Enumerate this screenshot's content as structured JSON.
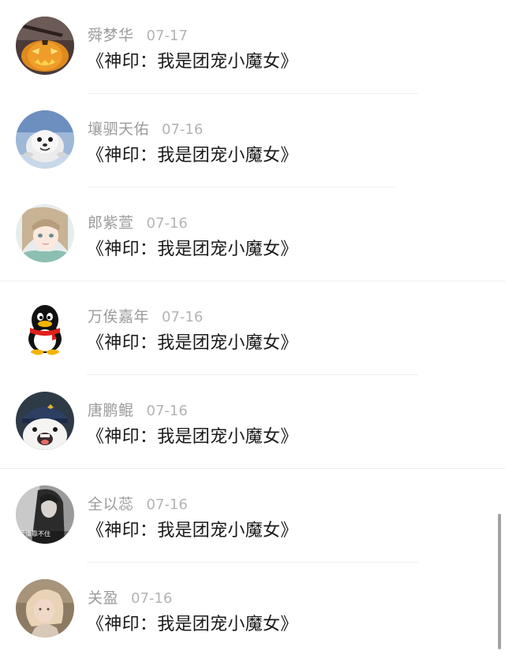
{
  "comments": [
    {
      "name": "舜梦华",
      "date": "07-17",
      "text": "《神印：我是团宠小魔女》",
      "avatar": "pumpkin-lantern-avatar"
    },
    {
      "name": "壤驷天佑",
      "date": "07-16",
      "text": "《神印：我是团宠小魔女》",
      "avatar": "seal-avatar"
    },
    {
      "name": "郎紫萱",
      "date": "07-16",
      "text": "《神印：我是团宠小魔女》",
      "avatar": "anime-girl-avatar"
    },
    {
      "name": "万俟嘉年",
      "date": "07-16",
      "text": "《神印：我是团宠小魔女》",
      "avatar": "penguin-avatar"
    },
    {
      "name": "唐鹏鲲",
      "date": "07-16",
      "text": "《神印：我是团宠小魔女》",
      "avatar": "cartoon-bear-avatar"
    },
    {
      "name": "全以蕊",
      "date": "07-16",
      "text": "《神印：我是团宠小魔女》",
      "avatar": "photo-avatar",
      "avatar_caption": "爱情靠不住"
    },
    {
      "name": "关盈",
      "date": "07-16",
      "text": "《神印：我是团宠小魔女》",
      "avatar": "girl-photo-avatar"
    }
  ],
  "colors": {
    "name": "#9b9b9b",
    "date": "#b3b3b3",
    "text": "#1a1a1a",
    "divider": "#eeeeee"
  }
}
